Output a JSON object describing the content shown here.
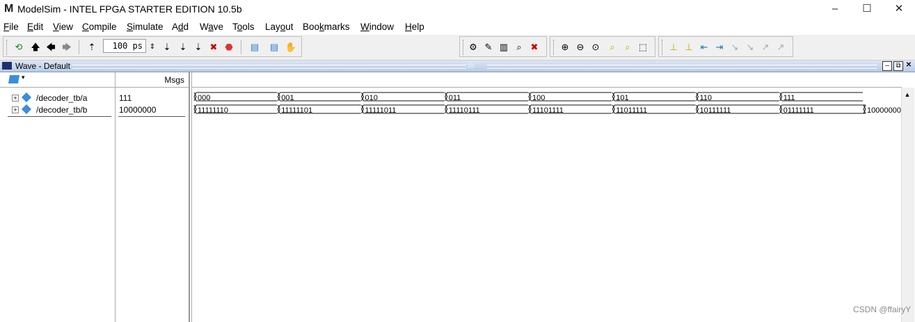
{
  "app": {
    "title": "ModelSim - INTEL FPGA STARTER EDITION 10.5b",
    "logo_letter": "M"
  },
  "window_controls": {
    "minimize": "–",
    "maximize": "☐",
    "close": "✕"
  },
  "menu": [
    {
      "pre": "",
      "u": "F",
      "post": "ile"
    },
    {
      "pre": "",
      "u": "E",
      "post": "dit"
    },
    {
      "pre": "",
      "u": "V",
      "post": "iew"
    },
    {
      "pre": "",
      "u": "C",
      "post": "ompile"
    },
    {
      "pre": "",
      "u": "S",
      "post": "imulate"
    },
    {
      "pre": "A",
      "u": "d",
      "post": "d"
    },
    {
      "pre": "W",
      "u": "a",
      "post": "ve"
    },
    {
      "pre": "T",
      "u": "o",
      "post": "ols"
    },
    {
      "pre": "Lay",
      "u": "o",
      "post": "ut"
    },
    {
      "pre": "Boo",
      "u": "k",
      "post": "marks"
    },
    {
      "pre": "",
      "u": "W",
      "post": "indow"
    },
    {
      "pre": "",
      "u": "H",
      "post": "elp"
    }
  ],
  "toolbar": {
    "run_length": "100 ps"
  },
  "wave_window": {
    "title": "Wave - Default"
  },
  "columns": {
    "msgs": "Msgs"
  },
  "signals": [
    {
      "name": "/decoder_tb/a",
      "value": "111"
    },
    {
      "name": "/decoder_tb/b",
      "value": "10000000"
    }
  ],
  "waveforms": {
    "a": [
      "000",
      "001",
      "010",
      "011",
      "100",
      "101",
      "110",
      "111"
    ],
    "b": [
      "11111110",
      "11111101",
      "11111011",
      "11110111",
      "11101111",
      "11011111",
      "10111111",
      "01111111",
      "10000000"
    ]
  },
  "watermark": "CSDN @ffairyY",
  "colors": {
    "header_gradient_top": "#dce6f4",
    "header_gradient_bottom": "#b9cbe6",
    "signal_icon": "#3b8edc"
  }
}
